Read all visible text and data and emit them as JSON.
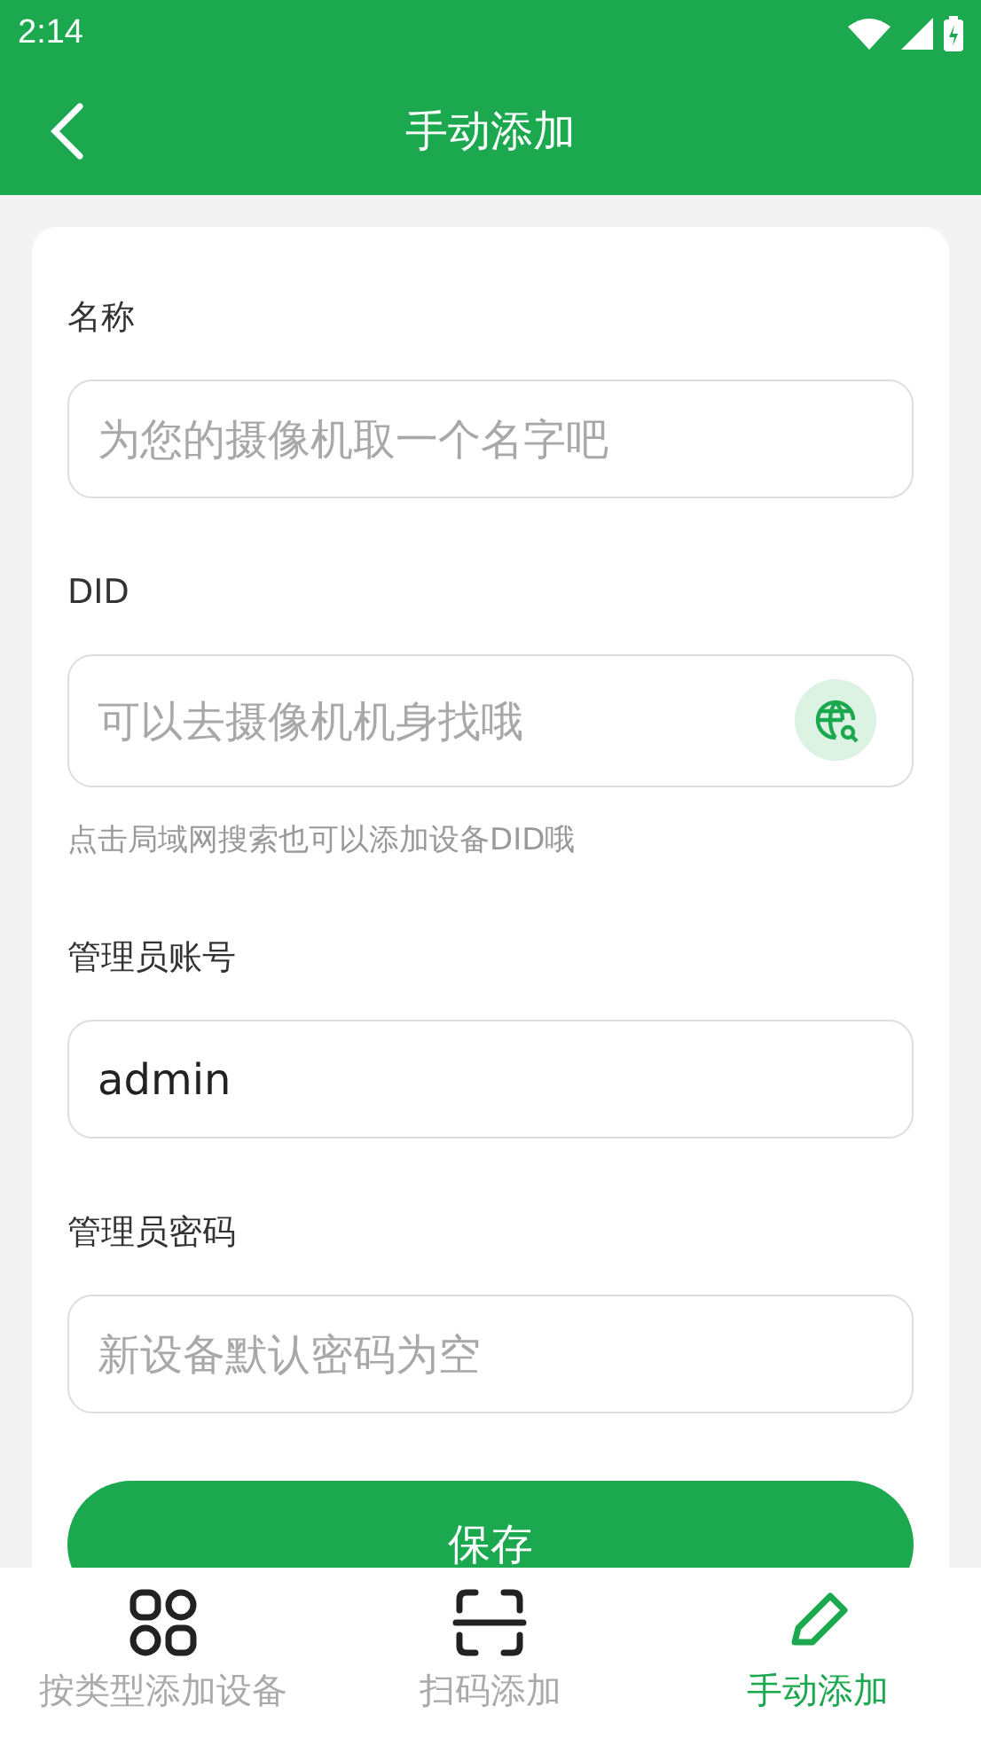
{
  "status_bar": {
    "time": "2:14"
  },
  "header": {
    "title": "手动添加"
  },
  "form": {
    "fields": [
      {
        "label": "名称",
        "kind": "text",
        "placeholder": "为您的摄像机取一个名字吧"
      },
      {
        "label": "DID",
        "kind": "search",
        "placeholder": "可以去摄像机机身找哦",
        "hint": "点击局域网搜索也可以添加设备DID哦"
      },
      {
        "label": "管理员账号",
        "kind": "text",
        "value": "admin"
      },
      {
        "label": "管理员密码",
        "kind": "text",
        "placeholder": "新设备默认密码为空"
      }
    ],
    "save_button": "保存"
  },
  "tabs": [
    {
      "label": "按类型添加设备",
      "kind": "grid",
      "selected": false
    },
    {
      "label": "扫码添加",
      "kind": "scan",
      "selected": false
    },
    {
      "label": "手动添加",
      "kind": "pencil",
      "selected": true
    }
  ]
}
